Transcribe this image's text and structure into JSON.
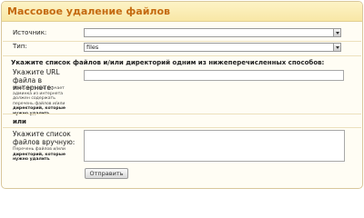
{
  "panel": {
    "title": "Массовое удаление файлов"
  },
  "form": {
    "source_label": "Источник:",
    "source_value": "",
    "type_label": "Тип:",
    "type_value": "files",
    "instruction": "Укажите список файлов и/или директорий одним из нижеперечисленных способов:",
    "url_label": "Укажите URL файла в интернете:",
    "url_hint_1": "Файл, который скачает админка из интернета должен содержать перечень файлов и/или",
    "url_hint_bold": "директорий, которые нужно удалить",
    "url_value": "",
    "or_label": "или",
    "manual_label": "Укажите список файлов вручную:",
    "manual_hint_1": "Перечень файлов и/или",
    "manual_hint_bold": "директорий, которые нужно удалить",
    "manual_value": "",
    "submit_label": "Отправить"
  }
}
